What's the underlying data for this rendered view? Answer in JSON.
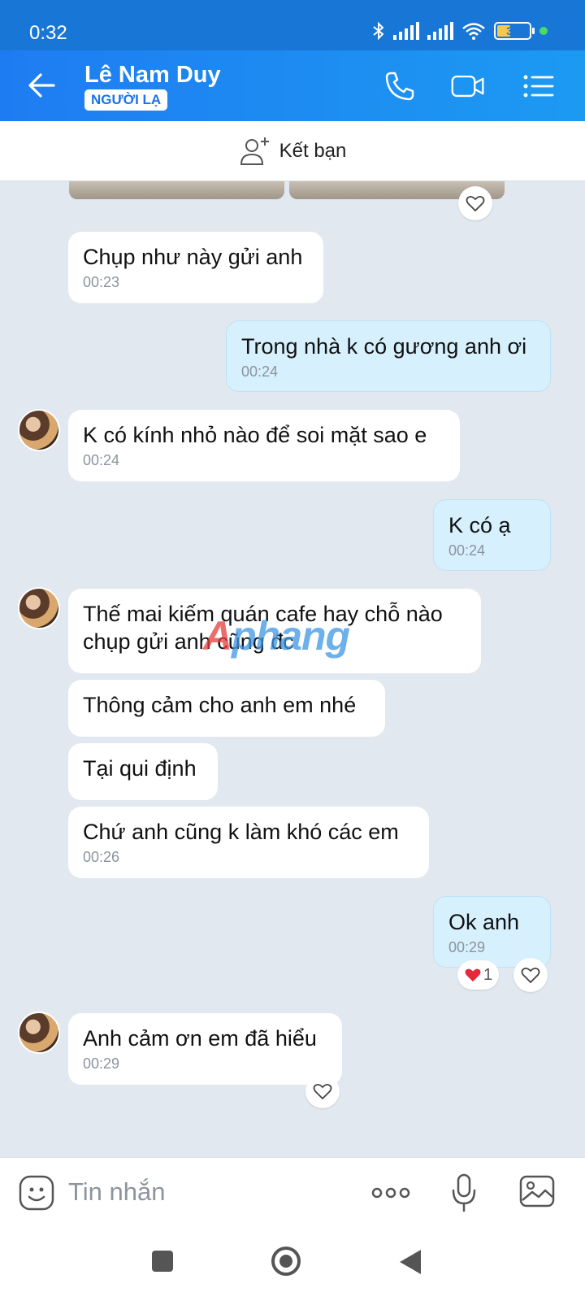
{
  "status_bar": {
    "time": "0:32",
    "battery": "39"
  },
  "header": {
    "contact_name": "Lê Nam Duy",
    "badge": "NGƯỜI LẠ"
  },
  "friend_bar": {
    "label": "Kết bạn"
  },
  "watermark": {
    "text_red": "A",
    "text_blue": "phang"
  },
  "messages": [
    {
      "text": "Chụp như này gửi anh",
      "time": "00:23"
    },
    {
      "text": "Trong nhà k có gương anh ơi",
      "time": "00:24"
    },
    {
      "text": "K có kính nhỏ nào để soi mặt sao e",
      "time": "00:24"
    },
    {
      "text": "K có ạ",
      "time": "00:24"
    },
    {
      "line1": "Thế mai kiếm quán cafe hay chỗ nào",
      "line2": "chụp gửi anh cũng đc"
    },
    {
      "text": "Thông cảm cho anh em nhé"
    },
    {
      "text": "Tại qui định"
    },
    {
      "text": "Chứ anh cũng k làm khó các em",
      "time": "00:26"
    },
    {
      "text": "Ok anh",
      "time": "00:29",
      "reaction_count": "1"
    },
    {
      "text": "Anh cảm ơn em đã hiểu",
      "time": "00:29"
    }
  ],
  "input": {
    "placeholder": "Tin nhắn"
  },
  "colors": {
    "header_blue": "#1e7cf2",
    "outgoing_bubble": "#d7f0fd",
    "chat_bg": "#e2e8ef"
  }
}
